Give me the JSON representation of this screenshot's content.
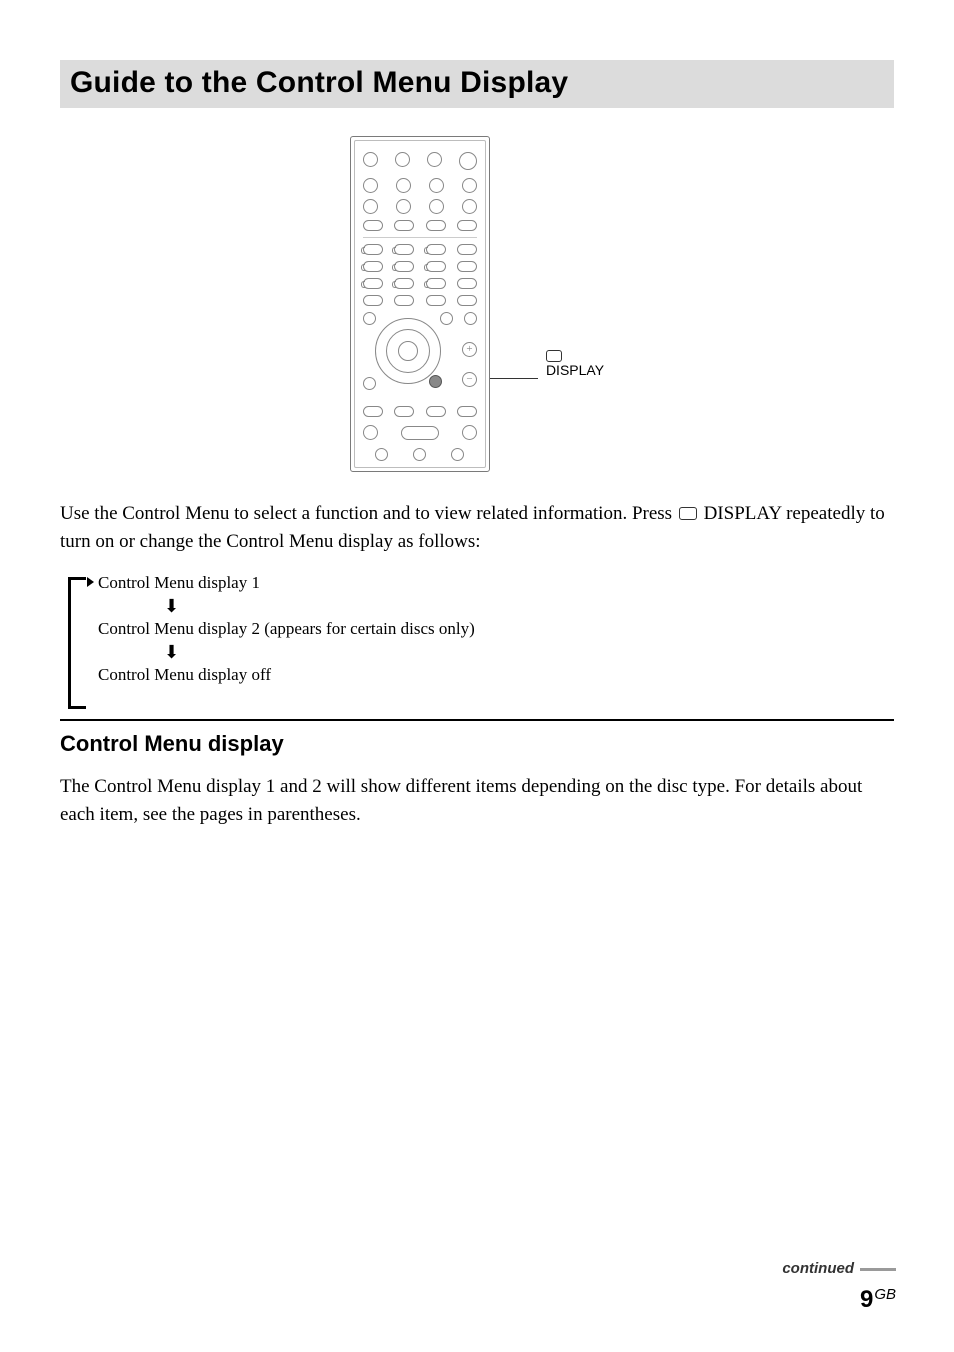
{
  "title": "Guide to the Control Menu Display",
  "remote": {
    "callout_label": "DISPLAY",
    "plus_glyph": "+",
    "minus_glyph": "−"
  },
  "paragraph1_pre": "Use the Control Menu to select a function and to view related information. Press ",
  "paragraph1_post": " DISPLAY repeatedly to turn on or change the Control Menu display as follows:",
  "cycle": {
    "line1": "Control Menu display 1",
    "line2": "Control Menu display 2 (appears for certain discs only)",
    "line3": "Control Menu display off"
  },
  "subhead": "Control Menu display",
  "paragraph2": "The Control Menu display 1 and 2 will show different items depending on the disc type. For details about each item, see the pages in parentheses.",
  "footer": {
    "continued": "continued",
    "page_number": "9",
    "region": "GB"
  }
}
